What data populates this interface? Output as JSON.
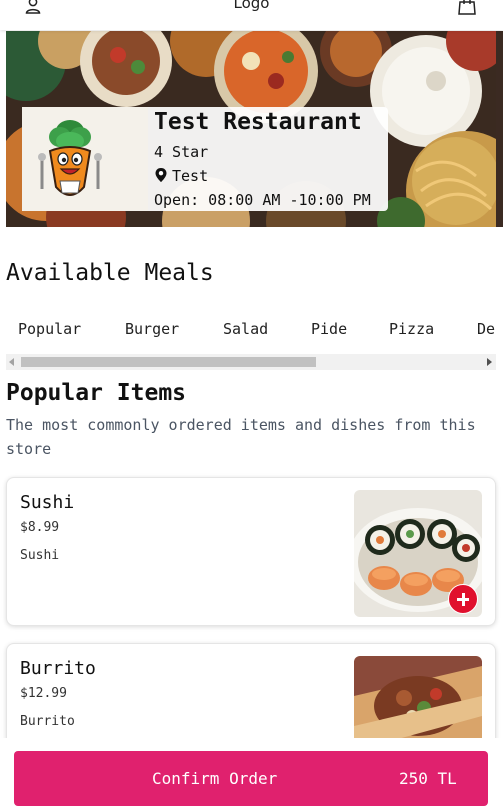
{
  "header": {
    "logo_text": "Logo",
    "user_icon": "user-icon",
    "cart_icon": "shopping-bag-icon"
  },
  "restaurant": {
    "name": "Test Restaurant",
    "rating_text": "4 Star",
    "location": "Test",
    "location_icon": "map-pin-icon",
    "hours": "Open: 08:00 AM -10:00 PM",
    "mascot": "carrot-chef-mascot"
  },
  "meals_section": {
    "title": "Available Meals",
    "tabs": [
      {
        "label": "Popular"
      },
      {
        "label": "Burger"
      },
      {
        "label": "Salad"
      },
      {
        "label": "Pide"
      },
      {
        "label": "Pizza"
      },
      {
        "label": "De"
      }
    ]
  },
  "popular": {
    "title": "Popular Items",
    "subtitle": "The most commonly ordered items and dishes from this store",
    "items": [
      {
        "name": "Sushi",
        "price": "$8.99",
        "description": "Sushi"
      },
      {
        "name": "Burrito",
        "price": "$12.99",
        "description": "Burrito"
      }
    ]
  },
  "order": {
    "confirm_label": "Confirm Order",
    "total": "250 TL"
  },
  "colors": {
    "accent": "#e0216e",
    "add_button": "#e0102d"
  }
}
